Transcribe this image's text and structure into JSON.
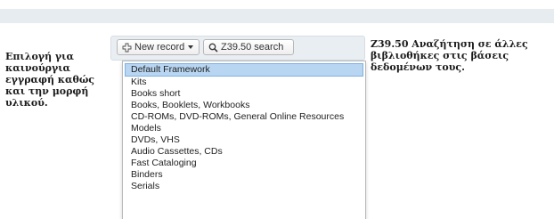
{
  "left_note": [
    "Επιλογή για",
    "καινούργια",
    "εγγραφή καθώς",
    "και την μορφή",
    "υλικού."
  ],
  "right_note": [
    "Z39.50 Αναζήτηση σε άλλες",
    "βιβλιοθήκες στις βάσεις",
    "δεδομένων τους."
  ],
  "toolbar": {
    "new_record_label": "New record",
    "z3950_label": "Z39.50 search"
  },
  "dropdown": {
    "selected": "Default Framework",
    "items": [
      "Default Framework",
      "Kits",
      "Books short",
      "Books, Booklets, Workbooks",
      "CD-ROMs, DVD-ROMs, General Online Resources",
      "Models",
      "DVDs, VHS",
      "Audio Cassettes, CDs",
      "Fast Cataloging",
      "Binders",
      "Serials"
    ]
  },
  "colors": {
    "highlight": "#b8d6f2",
    "highlight_border": "#7eb1e0",
    "top_bar": "#e6ecf0"
  },
  "icons": {
    "new_record": "plus-icon",
    "z3950": "search-icon"
  }
}
